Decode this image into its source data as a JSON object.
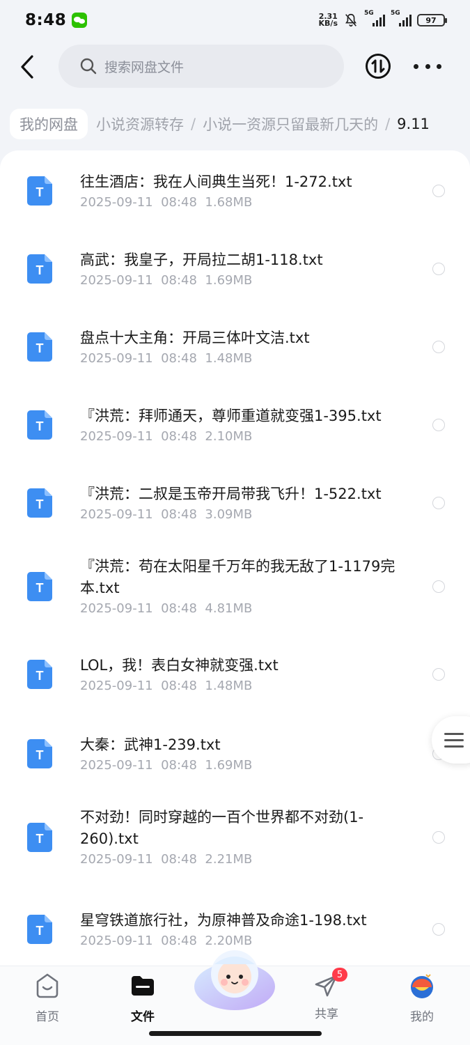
{
  "status_bar": {
    "time": "8:48",
    "net_speed_value": "2.31",
    "net_speed_unit": "KB/s",
    "signal1_label": "5G",
    "signal2_label": "5G",
    "battery": "97"
  },
  "header": {
    "search_placeholder": "搜索网盘文件"
  },
  "breadcrumb": {
    "root": "我的网盘",
    "items": [
      "小说资源转存",
      "小说一资源只留最新几天的"
    ],
    "separator": "/",
    "current": "9.11"
  },
  "files": [
    {
      "name": "往生酒店：我在人间典生当死！1-272.txt",
      "date": "2025-09-11",
      "time": "08:48",
      "size": "1.68MB"
    },
    {
      "name": "高武：我皇子，开局拉二胡1-118.txt",
      "date": "2025-09-11",
      "time": "08:48",
      "size": "1.69MB"
    },
    {
      "name": "盘点十大主角：开局三体叶文洁.txt",
      "date": "2025-09-11",
      "time": "08:48",
      "size": "1.48MB"
    },
    {
      "name": "『洪荒：拜师通天，尊师重道就变强1-395.txt",
      "date": "2025-09-11",
      "time": "08:48",
      "size": "2.10MB"
    },
    {
      "name": "『洪荒：二叔是玉帝开局带我飞升！1-522.txt",
      "date": "2025-09-11",
      "time": "08:48",
      "size": "3.09MB"
    },
    {
      "name": "『洪荒：苟在太阳星千万年的我无敌了1-1179完本.txt",
      "date": "2025-09-11",
      "time": "08:48",
      "size": "4.81MB"
    },
    {
      "name": "LOL，我！表白女神就变强.txt",
      "date": "2025-09-11",
      "time": "08:48",
      "size": "1.48MB"
    },
    {
      "name": "大秦：武神1-239.txt",
      "date": "2025-09-11",
      "time": "08:48",
      "size": "1.69MB"
    },
    {
      "name": "不对劲！同时穿越的一百个世界都不对劲(1-260).txt",
      "date": "2025-09-11",
      "time": "08:48",
      "size": "2.21MB"
    },
    {
      "name": "星穹铁道旅行社，为原神普及命途1-198.txt",
      "date": "2025-09-11",
      "time": "08:48",
      "size": "2.20MB"
    }
  ],
  "file_icon_letter": "T",
  "bottom_nav": {
    "home": "首页",
    "files": "文件",
    "share": "共享",
    "share_badge": "5",
    "me": "我的"
  },
  "colors": {
    "file_icon": "#3d8ef2",
    "badge": "#ff3b4a",
    "wechat": "#2dc100"
  }
}
